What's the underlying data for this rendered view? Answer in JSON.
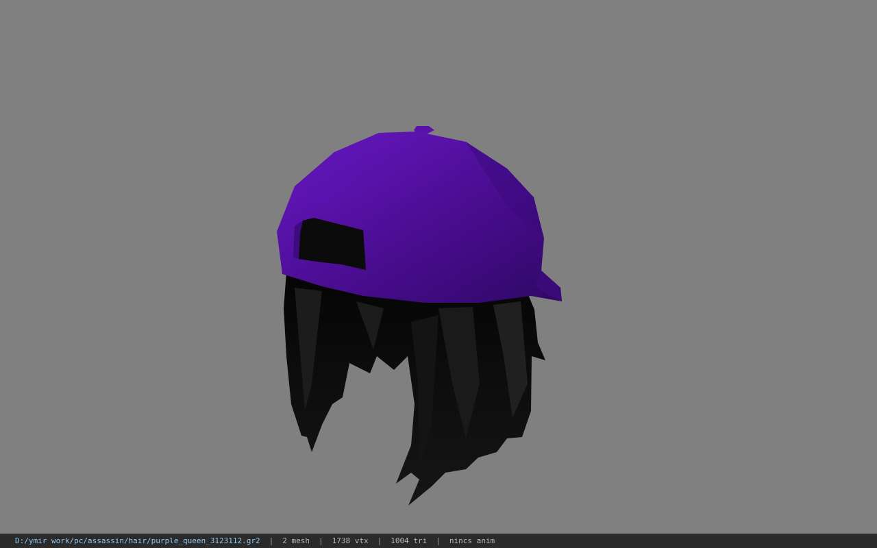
{
  "viewport": {
    "background_color": "#808080",
    "model": {
      "cap_color": "#4a0d91",
      "hair_color": "#0f0f0f"
    }
  },
  "status_bar": {
    "file_path": "D:/ymir work/pc/assassin/hair/purple_queen_3123112.gr2",
    "separator": "|",
    "mesh": "2 mesh",
    "vertices": "1738 vtx",
    "triangles": "1004 tri",
    "animation": "nincs anim"
  }
}
